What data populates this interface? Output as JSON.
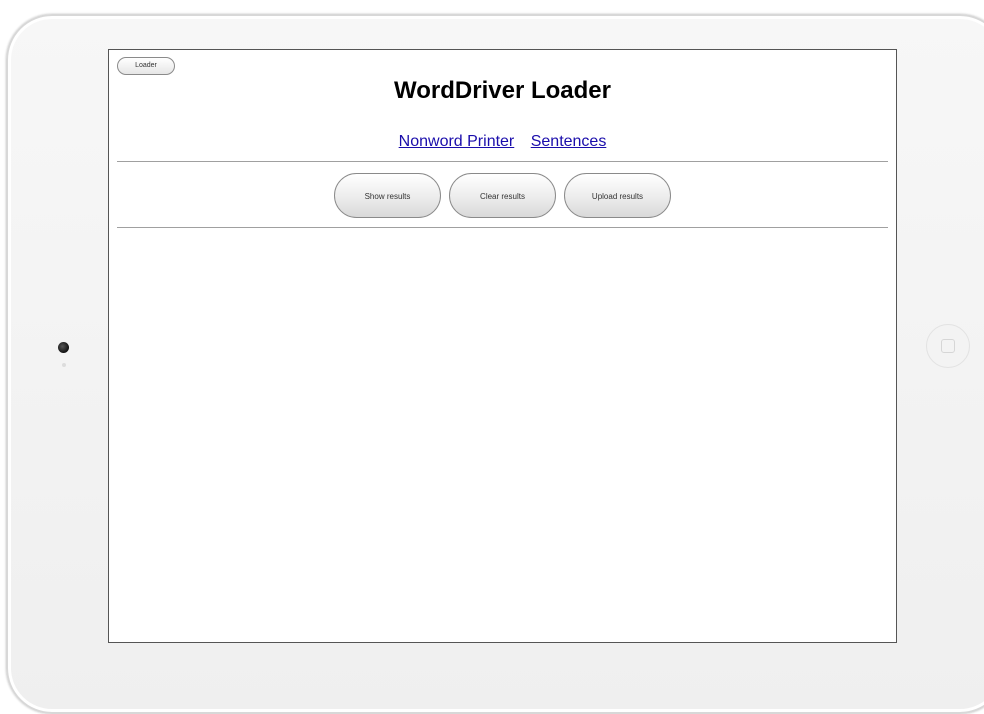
{
  "header": {
    "corner_button_label": "Loader",
    "title": "WordDriver Loader"
  },
  "nav": {
    "links": [
      {
        "label": "Nonword Printer"
      },
      {
        "label": "Sentences"
      }
    ]
  },
  "actions": {
    "buttons": [
      {
        "label": "Show results"
      },
      {
        "label": "Clear results"
      },
      {
        "label": "Upload results"
      }
    ]
  }
}
